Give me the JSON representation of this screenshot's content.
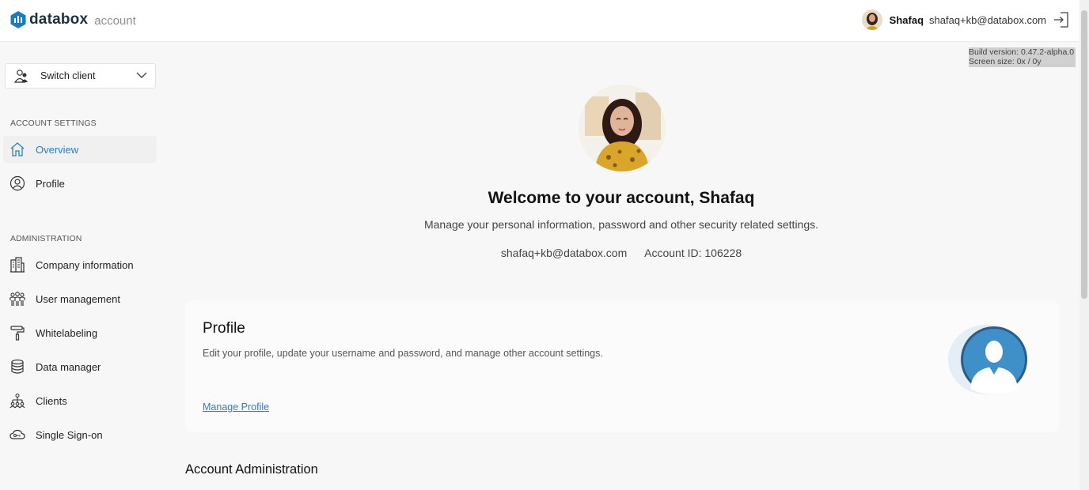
{
  "header": {
    "brand": "databox",
    "brand_sub": "account",
    "user_name": "Shafaq",
    "user_email": "shafaq+kb@databox.com",
    "logout_icon": "logout-icon"
  },
  "sidebar": {
    "switch_client_label": "Switch client",
    "section_account": "ACCOUNT SETTINGS",
    "section_admin": "ADMINISTRATION",
    "account_items": [
      {
        "label": "Overview",
        "icon": "home-icon",
        "active": true
      },
      {
        "label": "Profile",
        "icon": "user-circle-icon",
        "active": false
      }
    ],
    "admin_items": [
      {
        "label": "Company information",
        "icon": "building-icon"
      },
      {
        "label": "User management",
        "icon": "users-icon"
      },
      {
        "label": "Whitelabeling",
        "icon": "paint-roller-icon"
      },
      {
        "label": "Data manager",
        "icon": "database-icon"
      },
      {
        "label": "Clients",
        "icon": "hierarchy-icon"
      },
      {
        "label": "Single Sign-on",
        "icon": "cloud-key-icon"
      }
    ]
  },
  "debug": {
    "build_version": "Build version: 0.47.2-alpha.0",
    "screen_size": "Screen size: 0x / 0y"
  },
  "main": {
    "welcome": "Welcome to your account, Shafaq",
    "subtitle": "Manage your personal information, password and other security related settings.",
    "email": "shafaq+kb@databox.com",
    "account_id": "Account ID: 106228",
    "profile_card": {
      "title": "Profile",
      "description": "Edit your profile, update your username and password, and manage other account settings.",
      "link": "Manage Profile"
    },
    "admin_title": "Account Administration"
  },
  "colors": {
    "accent": "#2e7eb8",
    "brand_blue": "#1a7bc0",
    "background": "#f7f7f7"
  }
}
